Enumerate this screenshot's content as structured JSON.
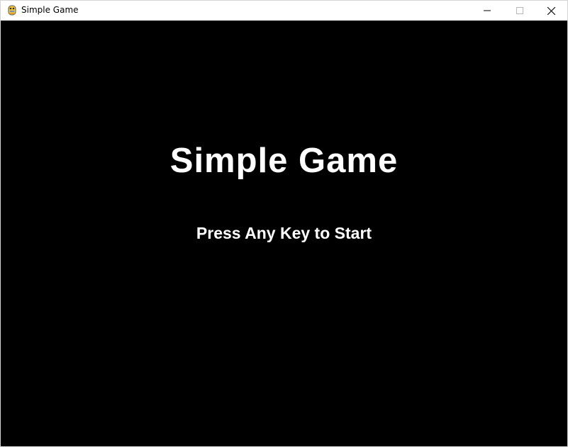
{
  "window": {
    "title": "Simple Game",
    "app_icon": "pygame-snake-icon",
    "controls": {
      "minimize_icon": "minimize-icon",
      "maximize_icon": "maximize-icon",
      "close_icon": "close-icon"
    }
  },
  "game": {
    "title": "Simple Game",
    "prompt": "Press Any Key to Start"
  },
  "colors": {
    "background": "#000000",
    "text": "#ffffff",
    "titlebar": "#ffffff",
    "icon_yellow": "#f5c842"
  }
}
